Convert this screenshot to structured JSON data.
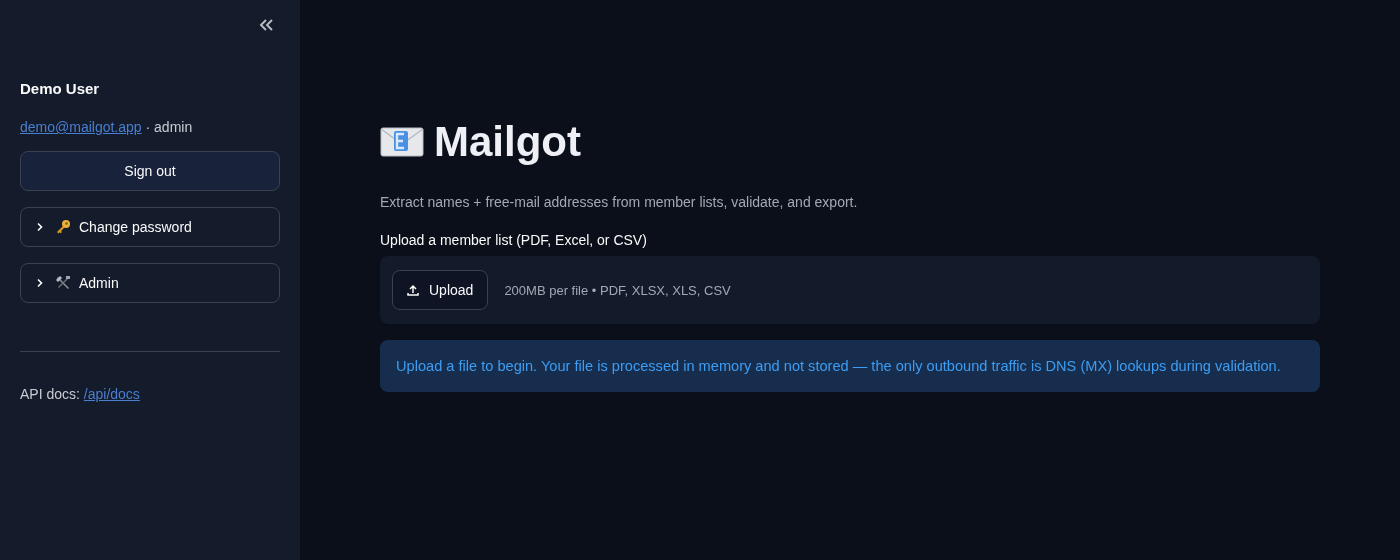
{
  "sidebar": {
    "user_name": "Demo User",
    "email": "demo@mailgot.app",
    "role": "· admin",
    "sign_out": "Sign out",
    "expanders": [
      {
        "label": "Change password",
        "expanded": false
      },
      {
        "label": "Admin",
        "expanded": false
      }
    ],
    "api_docs_label": "API docs:",
    "api_docs_link": "/api/docs"
  },
  "main": {
    "title": "Mailgot",
    "subtitle": "Extract names + free-mail addresses from member lists, validate, and export.",
    "uploader": {
      "label": "Upload a member list (PDF, Excel, or CSV)",
      "button": "Upload",
      "hint": "200MB per file • PDF, XLSX, XLS, CSV"
    },
    "info": "Upload a file to begin. Your file is processed in memory and not stored — the only outbound traffic is DNS (MX) lookups during validation."
  }
}
